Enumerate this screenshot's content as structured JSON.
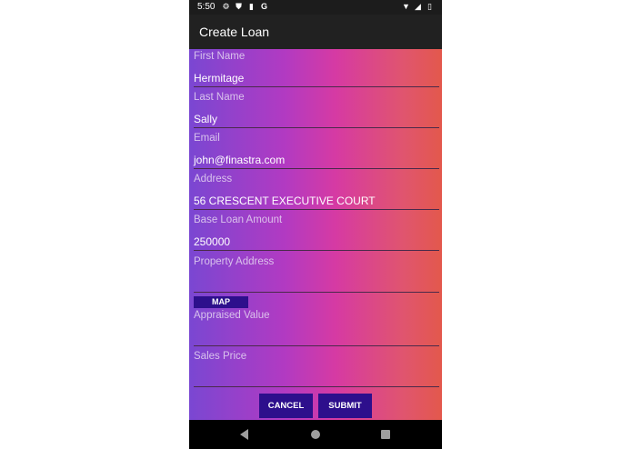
{
  "status_bar": {
    "time": "5:50",
    "left_icons": [
      "gear-icon",
      "shield-icon",
      "sd-card-icon",
      "google-icon"
    ],
    "right_icons": [
      "wifi-icon",
      "signal-icon",
      "battery-icon"
    ]
  },
  "app_bar": {
    "title": "Create Loan"
  },
  "form": {
    "fields": [
      {
        "label": "First Name",
        "value": "Hermitage"
      },
      {
        "label": "Last Name",
        "value": "Sally"
      },
      {
        "label": "Email",
        "value": "john@finastra.com"
      },
      {
        "label": "Address",
        "value": "56 CRESCENT EXECUTIVE COURT"
      },
      {
        "label": "Base Loan Amount",
        "value": "250000"
      },
      {
        "label": "Property Address",
        "value": ""
      },
      {
        "label": "Appraised Value",
        "value": ""
      },
      {
        "label": "Sales Price",
        "value": ""
      }
    ],
    "map_label": "MAP",
    "cancel_label": "CANCEL",
    "submit_label": "SUBMIT"
  },
  "colors": {
    "gradient_start": "#7a47d2",
    "gradient_mid": "#d63aa3",
    "gradient_end": "#e3584c",
    "button_bg": "#2d0f8c",
    "app_bar_bg": "#212121"
  }
}
